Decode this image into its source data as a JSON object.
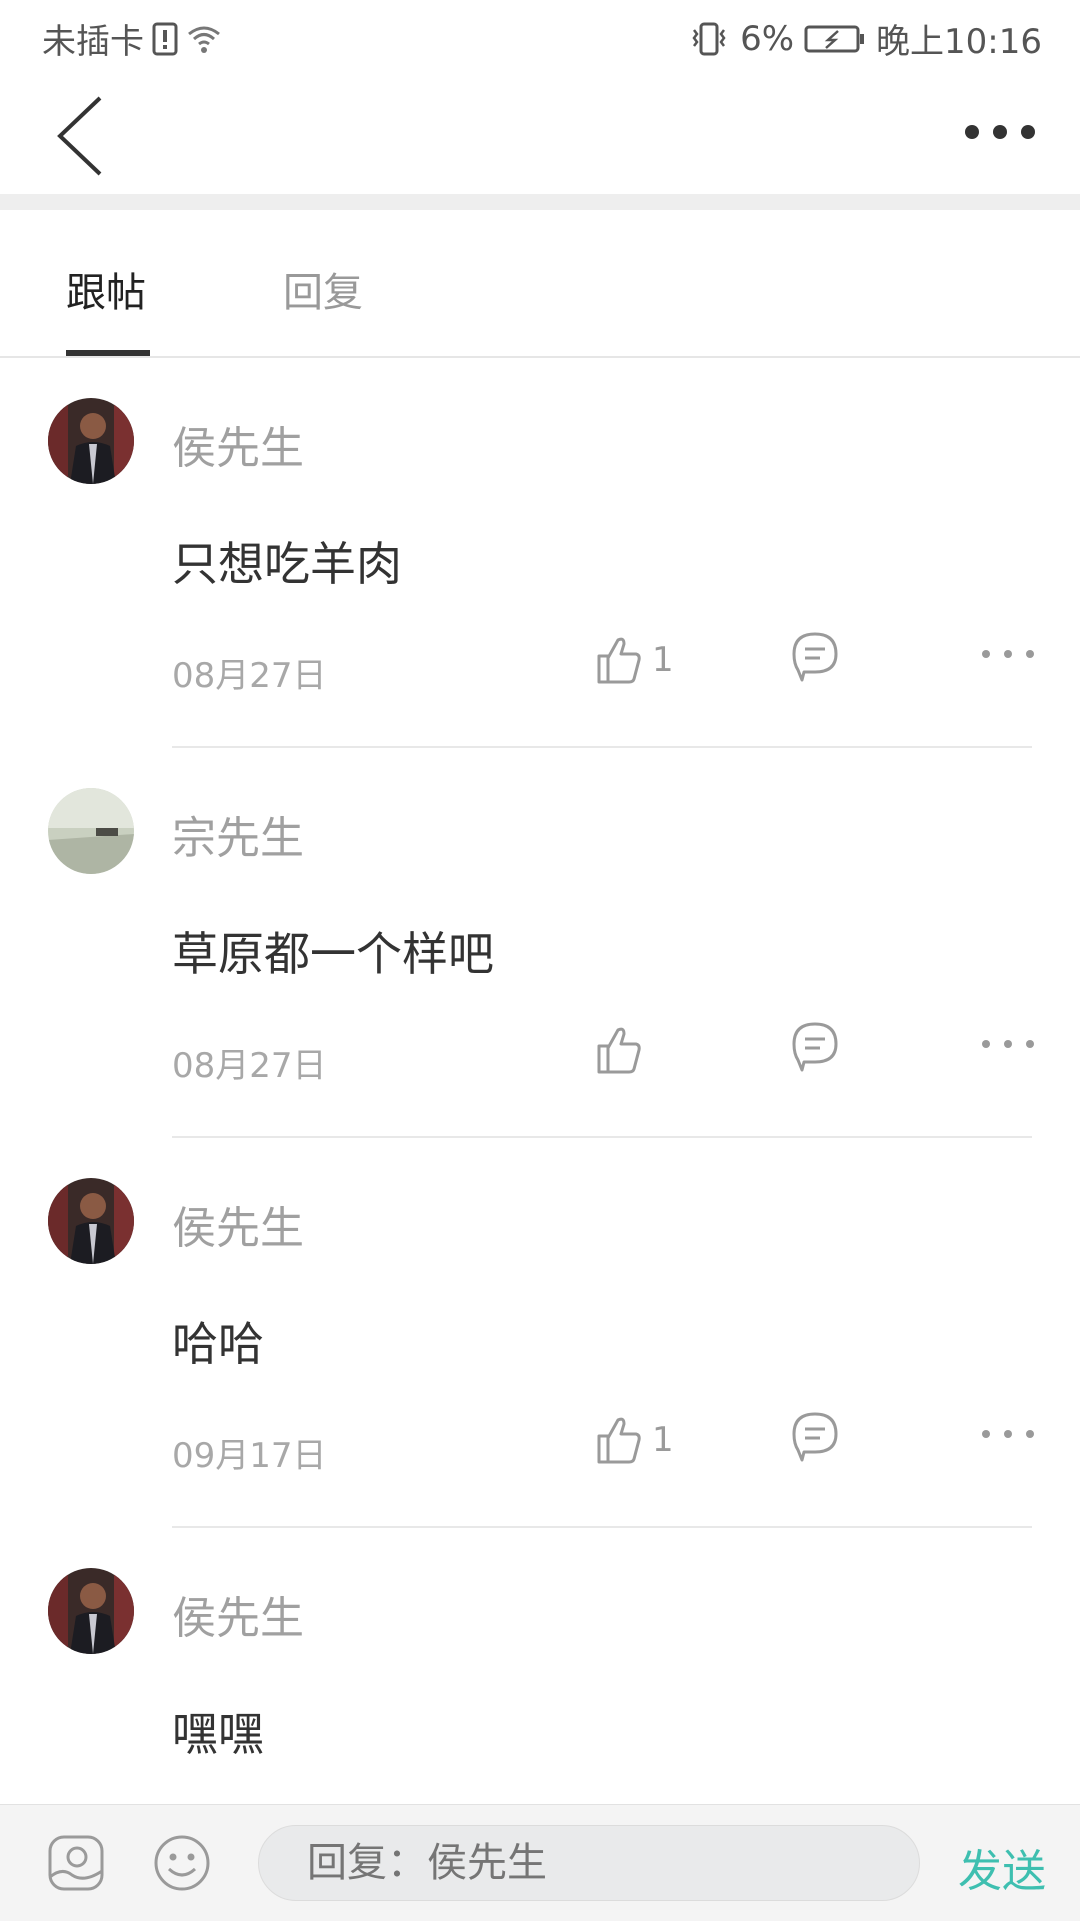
{
  "status_bar": {
    "carrier": "未插卡",
    "battery": "6%",
    "time": "晚上10:16"
  },
  "tabs": [
    {
      "label": "跟帖",
      "active": true
    },
    {
      "label": "回复",
      "active": false
    }
  ],
  "posts": [
    {
      "author": "侯先生",
      "content": "只想吃羊肉",
      "date": "08月27日",
      "likes": "1",
      "avatar": "avatar-dark"
    },
    {
      "author": "宗先生",
      "content": "草原都一个样吧",
      "date": "08月27日",
      "likes": "",
      "avatar": "avatar-light"
    },
    {
      "author": "侯先生",
      "content": "哈哈",
      "date": "09月17日",
      "likes": "1",
      "avatar": "avatar-dark"
    },
    {
      "author": "侯先生",
      "content": "嘿嘿",
      "date": "",
      "likes": "",
      "avatar": "avatar-dark"
    }
  ],
  "reply_bar": {
    "placeholder": "回复：侯先生",
    "send_label": "发送"
  },
  "colors": {
    "accent": "#3ebfb0",
    "muted": "#a0a0a0"
  }
}
